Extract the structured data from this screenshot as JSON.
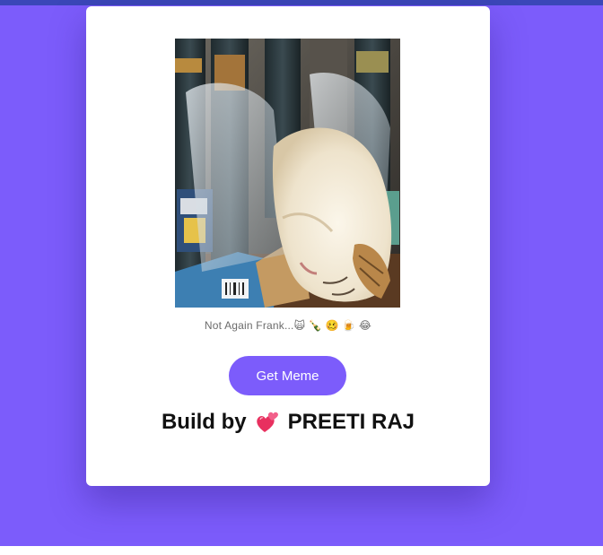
{
  "colors": {
    "page_background": "#7c5cfb",
    "top_strip": "#3b47b8",
    "button_background": "#7c5cfb",
    "card_background": "#ffffff"
  },
  "meme": {
    "image_alt": "Sleeping cat among wrapped beer bottles",
    "caption": "Not Again Frank...🙀 🍾 🥴 🍺 😂"
  },
  "actions": {
    "get_meme_label": "Get Meme"
  },
  "footer": {
    "build_by": "Build by",
    "heart_icon": "two-hearts-icon",
    "author": "PREETI RAJ"
  }
}
